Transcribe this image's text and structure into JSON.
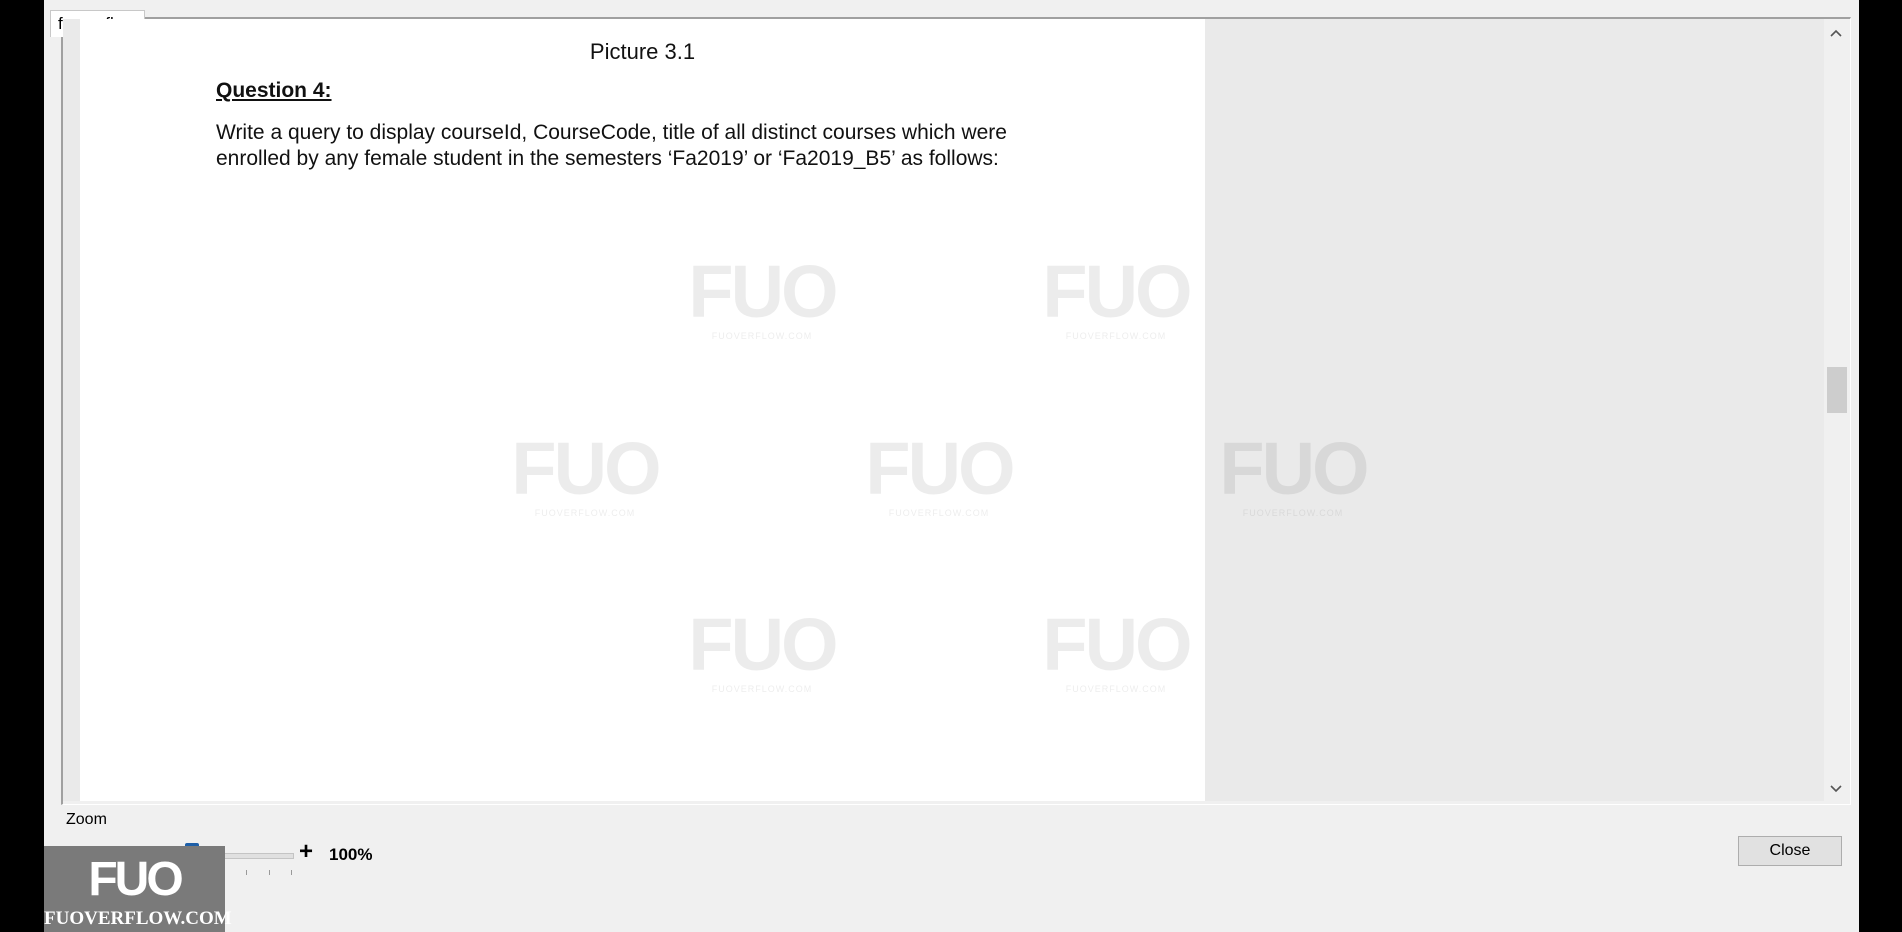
{
  "window": {
    "tab_label": "fuoverflow"
  },
  "document": {
    "picture_caption": "Picture 3.1",
    "question_title": "Question 4:",
    "question_text_line1": "Write a query to display courseId, CourseCode, title of all distinct courses which were",
    "question_text_line2": "enrolled by any female student in the semesters ‘Fa2019’ or ‘Fa2019_B5’ as follows:",
    "watermark_mark": "FUO",
    "watermark_text": "FUOVERFLOW.COM"
  },
  "zoom": {
    "label": "Zoom",
    "minus": "-",
    "plus": "+",
    "value": "100%",
    "level_percent": 100
  },
  "buttons": {
    "close": "Close"
  },
  "brand": {
    "logo_mark": "FUO",
    "logo_text": "FUOVERFLOW.COM"
  },
  "icons": {
    "scroll_up": "chevron-up-icon",
    "scroll_down": "chevron-down-icon"
  },
  "colors": {
    "slider_thumb": "#1e5fa8",
    "window_bg": "#f0f0f0"
  }
}
